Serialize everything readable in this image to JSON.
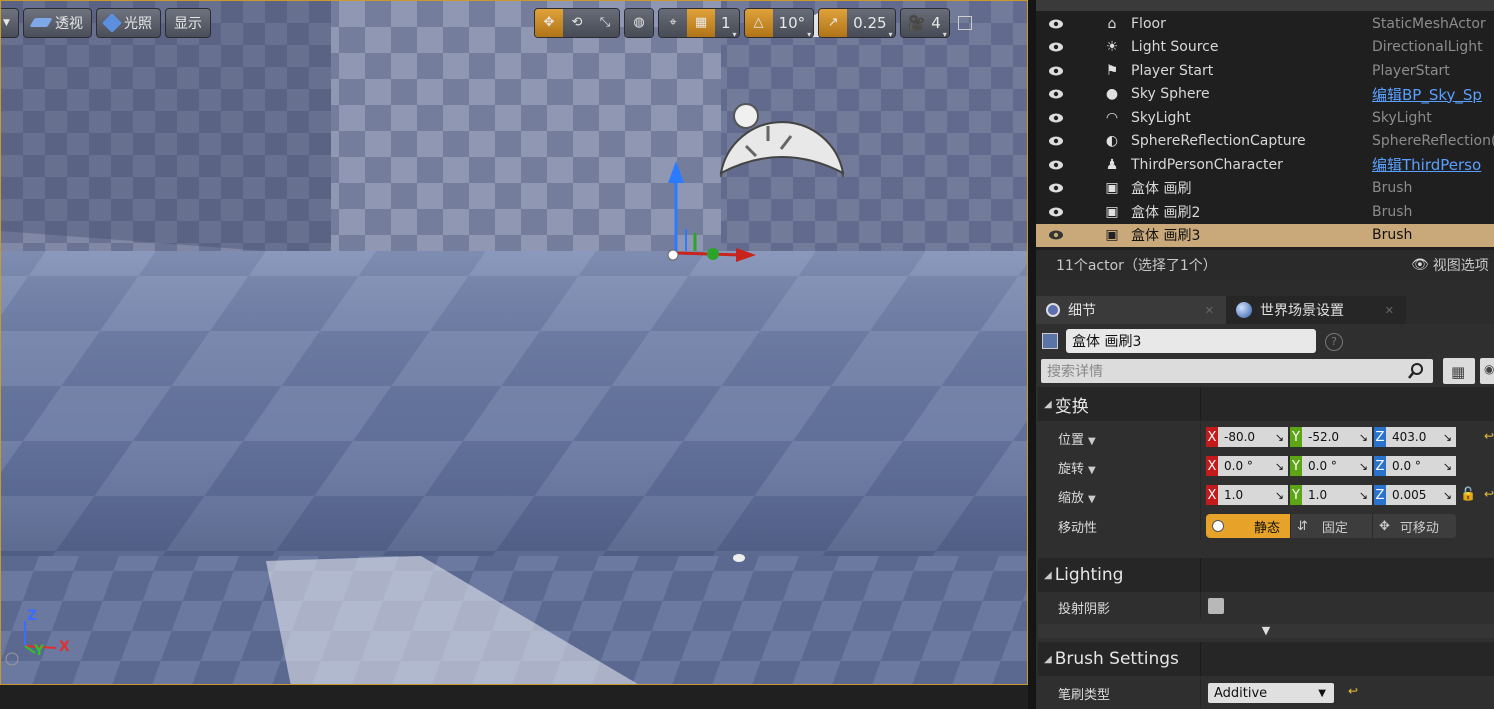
{
  "viewport": {
    "toolbar": {
      "perspective_label": "透视",
      "lighting_label": "光照",
      "show_label": "显示",
      "grid_size": "1",
      "rotation_snap": "10°",
      "scale_snap": "0.25",
      "camera_speed": "4"
    },
    "axes": {
      "z": "Z",
      "y": "Y",
      "x": "X"
    }
  },
  "outliner": {
    "rows": [
      {
        "name": "Floor",
        "type": "StaticMeshActor",
        "icon": "static-mesh-icon",
        "link": false
      },
      {
        "name": "Light Source",
        "type": "DirectionalLight",
        "icon": "directional-light-icon",
        "link": false
      },
      {
        "name": "Player Start",
        "type": "PlayerStart",
        "icon": "player-start-icon",
        "link": false
      },
      {
        "name": "Sky Sphere",
        "type": "编辑BP_Sky_Sp",
        "icon": "sphere-icon",
        "link": true
      },
      {
        "name": "SkyLight",
        "type": "SkyLight",
        "icon": "skylight-icon",
        "link": false
      },
      {
        "name": "SphereReflectionCapture",
        "type": "SphereReflection(",
        "icon": "reflection-capture-icon",
        "link": false
      },
      {
        "name": "ThirdPersonCharacter",
        "type": "编辑ThirdPerso",
        "icon": "character-icon",
        "link": true
      },
      {
        "name": "盒体 画刷",
        "type": "Brush",
        "icon": "brush-icon",
        "link": false
      },
      {
        "name": "盒体 画刷2",
        "type": "Brush",
        "icon": "brush-icon",
        "link": false
      },
      {
        "name": "盒体 画刷3",
        "type": "Brush",
        "icon": "brush-icon",
        "link": false,
        "selected": true
      }
    ],
    "footer_count": "11个actor（选择了1个）",
    "view_options": "视图选项"
  },
  "tabs": [
    {
      "label": "细节",
      "active": true
    },
    {
      "label": "世界场景设置",
      "active": false
    }
  ],
  "details": {
    "actor_name": "盒体 画刷3",
    "search_placeholder": "搜索详情",
    "transform": {
      "title": "变换",
      "location_label": "位置",
      "rotation_label": "旋转",
      "scale_label": "缩放",
      "mobility_label": "移动性",
      "location": {
        "x": "-80.0",
        "y": "-52.0",
        "z": "403.0"
      },
      "rotation": {
        "x": "0.0 °",
        "y": "0.0 °",
        "z": "0.0 °"
      },
      "scale": {
        "x": "1.0",
        "y": "1.0",
        "z": "0.005"
      },
      "mobility": {
        "static": "静态",
        "fixed": "固定",
        "movable": "可移动",
        "selected": "static"
      }
    },
    "lighting": {
      "title": "Lighting",
      "cast_shadow_label": "投射阴影",
      "cast_shadow": false
    },
    "brush": {
      "title": "Brush Settings",
      "brush_type_label": "笔刷类型",
      "brush_type": "Additive"
    }
  },
  "colors": {
    "accent": "#e6a229",
    "selection": "#c9a87a",
    "link": "#5aa0ff"
  }
}
